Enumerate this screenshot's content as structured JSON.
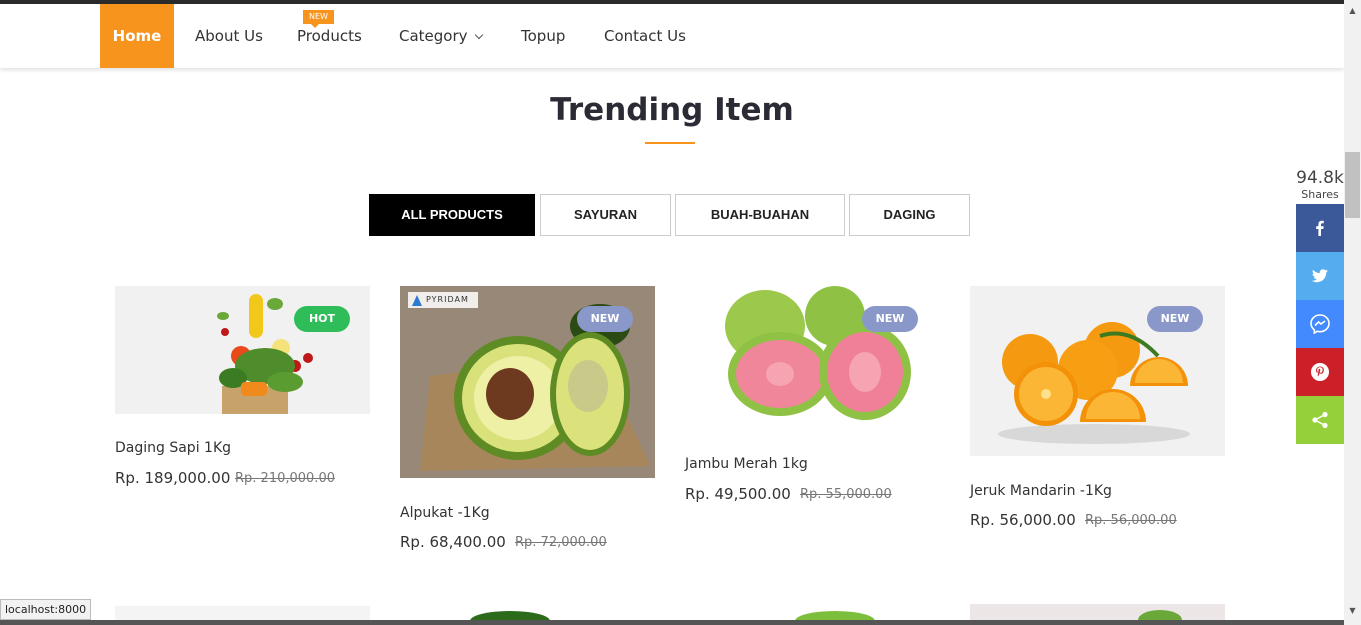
{
  "nav": {
    "home": "Home",
    "about": "About Us",
    "products": "Products",
    "products_badge": "NEW",
    "category": "Category",
    "topup": "Topup",
    "contact": "Contact Us"
  },
  "section": {
    "title": "Trending Item"
  },
  "filters": [
    "ALL PRODUCTS",
    "SAYURAN",
    "BUAH-BUAHAN",
    "DAGING"
  ],
  "products": [
    {
      "badge": "HOT",
      "name": "Daging Sapi 1Kg",
      "price": "Rp. 189,000.00",
      "old_price": "Rp. 210,000.00"
    },
    {
      "badge": "NEW",
      "name": "Alpukat -1Kg",
      "price": "Rp. 68,400.00",
      "old_price": "Rp. 72,000.00",
      "watermark": "PYRIDAM"
    },
    {
      "badge": "NEW",
      "name": "Jambu Merah 1kg",
      "price": "Rp. 49,500.00",
      "old_price": "Rp. 55,000.00"
    },
    {
      "badge": "NEW",
      "name": "Jeruk Mandarin -1Kg",
      "price": "Rp. 56,000.00",
      "old_price": "Rp. 56,000.00"
    }
  ],
  "share": {
    "count": "94.8k",
    "label": "Shares",
    "buttons": [
      {
        "icon": "facebook-icon",
        "color": "#3b5998"
      },
      {
        "icon": "twitter-icon",
        "color": "#55acee"
      },
      {
        "icon": "messenger-icon",
        "color": "#448aff"
      },
      {
        "icon": "pinterest-icon",
        "color": "#cb2027"
      },
      {
        "icon": "share-icon",
        "color": "#95d03a"
      }
    ]
  },
  "status_url": "localhost:8000",
  "colors": {
    "accent": "#f7941d",
    "hot": "#2fbd5a",
    "new": "#8a98c9",
    "active_filter": "#000000"
  }
}
